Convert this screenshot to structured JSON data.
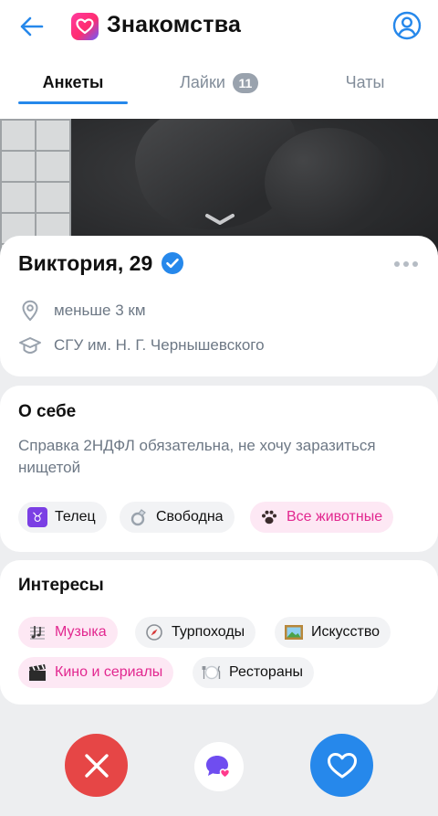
{
  "header": {
    "title": "Знакомства",
    "back_icon": "arrow-left-icon",
    "logo_icon": "heart-app-logo-icon",
    "profile_icon": "user-circle-icon"
  },
  "tabs": [
    {
      "label": "Анкеты",
      "active": true
    },
    {
      "label": "Лайки",
      "badge": "11",
      "active": false
    },
    {
      "label": "Чаты",
      "active": false
    }
  ],
  "profile": {
    "name": "Виктория, 29",
    "verified": true,
    "distance": "меньше 3 км",
    "education": "СГУ им. Н. Г. Чернышевского"
  },
  "about": {
    "title": "О себе",
    "text": "Справка 2НДФЛ обязательна, не хочу заразиться нищетой",
    "chips": [
      {
        "label": "Телец",
        "icon": "♉",
        "highlight": false
      },
      {
        "label": "Свободна",
        "icon": "💍",
        "highlight": false
      },
      {
        "label": "Все животные",
        "icon": "🐾",
        "highlight": true
      }
    ]
  },
  "interests": {
    "title": "Интересы",
    "chips": [
      {
        "label": "Музыка",
        "icon": "🎼",
        "highlight": true
      },
      {
        "label": "Турпоходы",
        "icon": "🧭",
        "highlight": false
      },
      {
        "label": "Искусство",
        "icon": "🖼",
        "highlight": false
      },
      {
        "label": "Кино и сериалы",
        "icon": "🎬",
        "highlight": true
      },
      {
        "label": "Рестораны",
        "icon": "🍽",
        "highlight": false
      }
    ]
  },
  "actions": {
    "dislike_icon": "close-icon",
    "message_icon": "message-heart-icon",
    "like_icon": "heart-outline-icon"
  },
  "colors": {
    "accent": "#2688eb",
    "dislike": "#e64646",
    "pink_chip_bg": "#fde8f4",
    "pink_chip_text": "#e2278f"
  }
}
